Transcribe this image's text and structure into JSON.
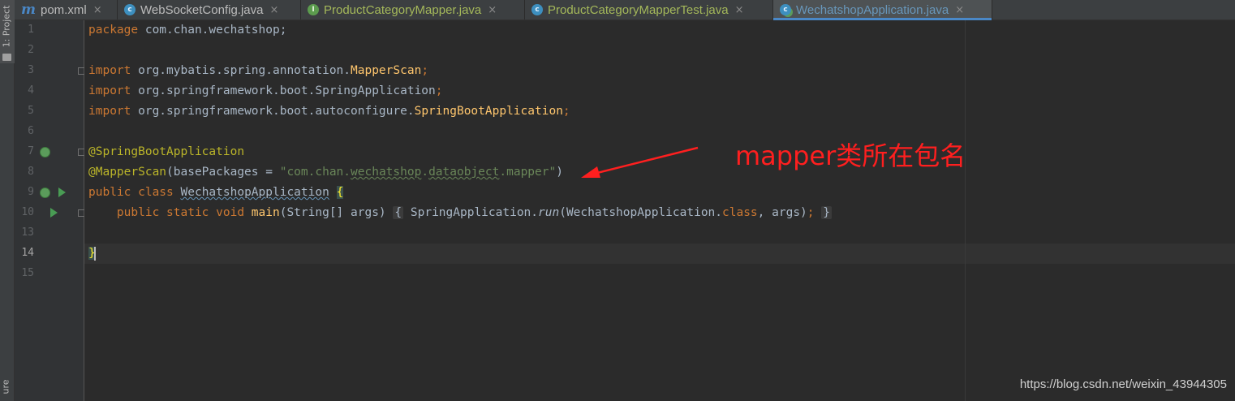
{
  "tool_window": {
    "project_label": "1: Project",
    "structure_label": "ure"
  },
  "tabs": [
    {
      "label": "pom.xml",
      "icon": "maven-icon",
      "active": false
    },
    {
      "label": "WebSocketConfig.java",
      "icon": "class-icon",
      "active": false
    },
    {
      "label": "ProductCategoryMapper.java",
      "icon": "interface-icon",
      "active": false
    },
    {
      "label": "ProductCategoryMapperTest.java",
      "icon": "test-class-icon",
      "active": false
    },
    {
      "label": "WechatshopApplication.java",
      "icon": "spring-boot-class-icon",
      "active": true
    }
  ],
  "tab_close_glyph": "×",
  "line_numbers": [
    "1",
    "2",
    "3",
    "4",
    "5",
    "6",
    "7",
    "8",
    "9",
    "10",
    "13",
    "14",
    "15"
  ],
  "current_line": "14",
  "code": {
    "l1_kw": "package",
    "l1_rest": " com.chan.wechatshop;",
    "l3_kw": "import",
    "l3_pkg": " org.mybatis.spring.annotation.",
    "l3_cls": "MapperScan",
    "l3_end": ";",
    "l4_kw": "import",
    "l4_pkg": " org.springframework.boot.SpringApplication",
    "l4_end": ";",
    "l5_kw": "import",
    "l5_pkg": " org.springframework.boot.autoconfigure.",
    "l5_cls": "SpringBootApplication",
    "l5_end": ";",
    "l7_ann": "@SpringBootApplication",
    "l8_ann": "@MapperScan",
    "l8_open": "(basePackages = ",
    "l8_str_a": "\"com.chan.",
    "l8_str_b": "wechatshop",
    "l8_str_c": ".",
    "l8_str_d": "dataobject",
    "l8_str_e": ".mapper\"",
    "l8_close": ")",
    "l9_kw": "public class",
    "l9_cls": "WechatshopApplication",
    "l9_brace": "{",
    "l10_kw": "public static void",
    "l10_fn": "main",
    "l10_params": "(String[] args)",
    "l10_fold_open": "{",
    "l10_body_a": "SpringApplication.",
    "l10_run": "run",
    "l10_body_b": "(WechatshopApplication.",
    "l10_class_kw": "class",
    "l10_body_c": ", args)",
    "l10_semi": ";",
    "l10_fold_close": "}",
    "l14_brace": "}"
  },
  "annotation": {
    "text": "mapper类所在包名",
    "color": "#ff1f1f"
  },
  "watermark": "https://blog.csdn.net/weixin_43944305",
  "colors": {
    "background": "#2b2b2b",
    "keyword": "#cc7832",
    "annotation": "#bbb529",
    "string": "#6a8759",
    "method": "#ffc66d",
    "active_tab_accent": "#4a88c7"
  }
}
